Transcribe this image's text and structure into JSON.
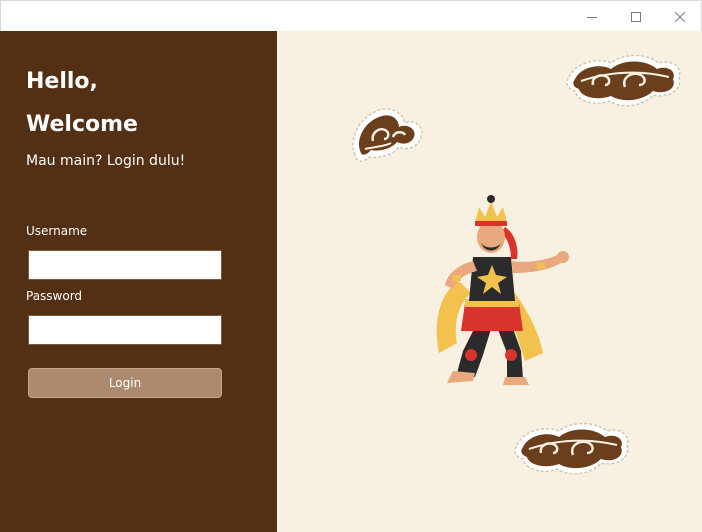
{
  "window": {
    "controls": [
      "minimize-icon",
      "maximize-icon",
      "close-icon"
    ]
  },
  "colors": {
    "panel": "#532f14",
    "background": "#f8f1e2",
    "button": "#ad8a6e",
    "cloud": "#6b3f1c"
  },
  "greeting": {
    "line1": "Hello,",
    "line2": "Welcome",
    "subtitle": "Mau main? Login dulu!"
  },
  "form": {
    "username_label": "Username",
    "username_value": "",
    "password_label": "Password",
    "password_value": "",
    "login_label": "Login"
  },
  "decorations": [
    "megamendung-cloud-icon",
    "megamendung-cloud-icon",
    "megamendung-cloud-icon",
    "wayang-character-illustration"
  ]
}
